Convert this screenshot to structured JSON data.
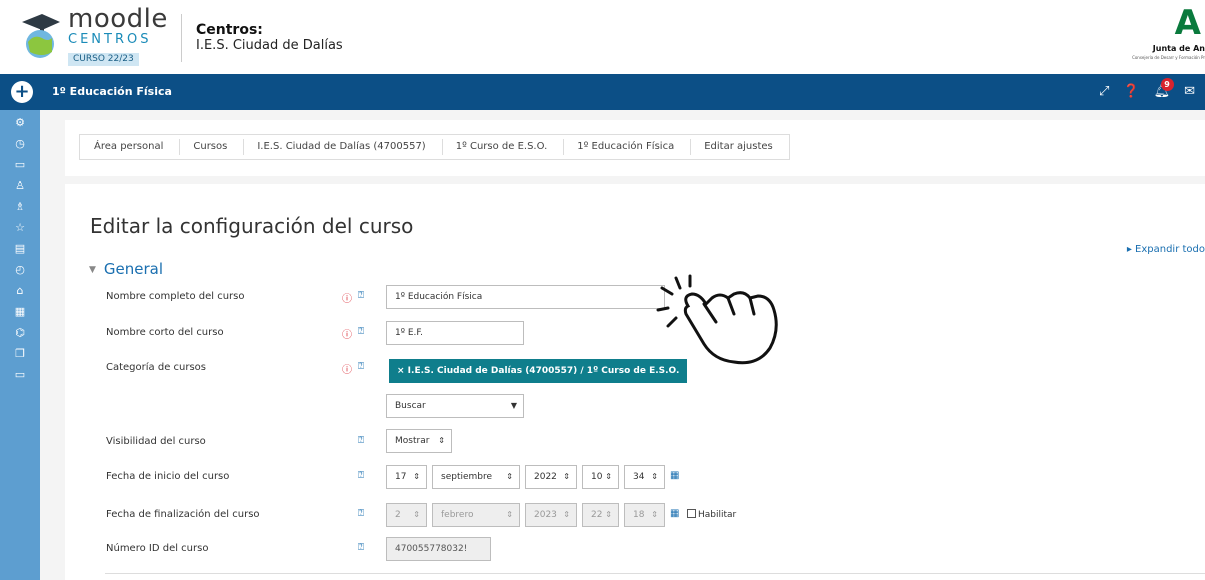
{
  "header": {
    "logo_word": "moodle",
    "logo_sub": "CENTROS",
    "logo_year": "CURSO 22/23",
    "centros_label": "Centros:",
    "centros_name": "I.E.S. Ciudad de Dalías",
    "junta_text": "Junta de An",
    "junta_sub": "Consejería de Desarr y Formación Pr"
  },
  "navbar": {
    "course_title": "1º Educación Física",
    "notification_count": "9",
    "colors": {
      "bar": "#0c4f86",
      "badge": "#d9232e"
    }
  },
  "sidebar": {
    "icons": [
      "gears-icon",
      "clock-icon",
      "folder-icon",
      "users-icon",
      "badge-icon",
      "star-icon",
      "book-icon",
      "dashboard-icon",
      "home-icon",
      "calendar-icon",
      "graduation-cap-icon",
      "files-icon",
      "folder-icon"
    ]
  },
  "breadcrumb": {
    "items": [
      "Área personal",
      "Cursos",
      "I.E.S. Ciudad de Dalías (4700557)",
      "1º Curso de E.S.O.",
      "1º Educación Física",
      "Editar ajustes"
    ]
  },
  "main": {
    "title": "Editar la configuración del curso",
    "expand_all": "▸ Expandir todo",
    "section": "General",
    "fields": {
      "fullname_label": "Nombre completo del curso",
      "fullname_value": "1º Educación Física",
      "shortname_label": "Nombre corto del curso",
      "shortname_value": "1º E.F.",
      "category_label": "Categoría de cursos",
      "category_tag": "× I.E.S. Ciudad de Dalías (4700557) / 1º Curso de E.S.O.",
      "category_search": "Buscar",
      "visibility_label": "Visibilidad del curso",
      "visibility_value": "Mostrar",
      "start_label": "Fecha de inicio del curso",
      "start_day": "17",
      "start_month": "septiembre",
      "start_year": "2022",
      "start_hour": "10",
      "start_min": "34",
      "end_label": "Fecha de finalización del curso",
      "end_day": "2",
      "end_month": "febrero",
      "end_year": "2023",
      "end_hour": "22",
      "end_min": "18",
      "end_enable": "Habilitar",
      "idnumber_label": "Número ID del curso",
      "idnumber_value": "470055778032!"
    }
  },
  "icons": {
    "required": "⓵",
    "help": "?"
  }
}
